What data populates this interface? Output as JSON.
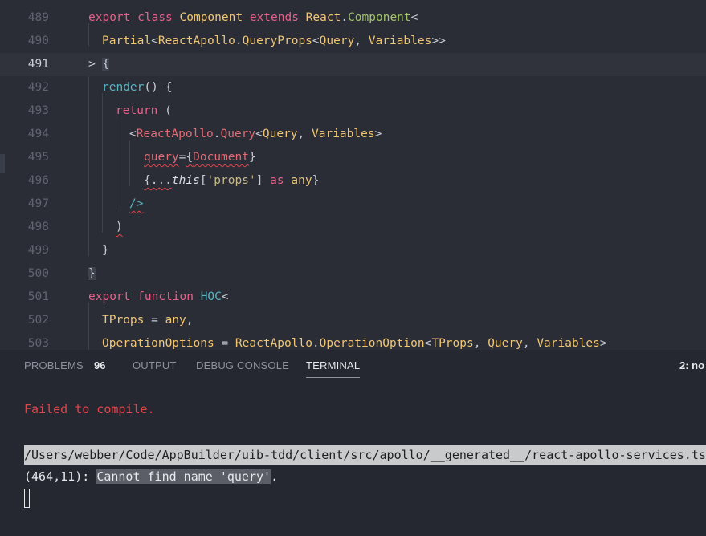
{
  "editor": {
    "lines": [
      {
        "n": "489"
      },
      {
        "n": "490"
      },
      {
        "n": "491"
      },
      {
        "n": "492"
      },
      {
        "n": "493"
      },
      {
        "n": "494"
      },
      {
        "n": "495"
      },
      {
        "n": "496"
      },
      {
        "n": "497"
      },
      {
        "n": "498"
      },
      {
        "n": "499"
      },
      {
        "n": "500"
      },
      {
        "n": "501"
      },
      {
        "n": "502"
      },
      {
        "n": "503"
      }
    ],
    "code": {
      "l489": [
        "export",
        " ",
        "class",
        " ",
        "Component",
        " ",
        "extends",
        " ",
        "React",
        ".",
        "Component",
        "<"
      ],
      "l490": [
        "Partial",
        "<",
        "ReactApollo",
        ".",
        "QueryProps",
        "<",
        "Query",
        ", ",
        "Variables",
        ">>"
      ],
      "l491": [
        "> ",
        "{"
      ],
      "l492": [
        "render",
        "() {"
      ],
      "l493": [
        "return",
        " ("
      ],
      "l494": [
        "<",
        "ReactApollo",
        ".",
        "Query",
        "<",
        "Query",
        ", ",
        "Variables",
        ">"
      ],
      "l495": [
        "query",
        "=",
        "{",
        "Document",
        "}"
      ],
      "l496": [
        "{...",
        "this",
        "[",
        "'props'",
        "] ",
        "as",
        " ",
        "any",
        "}"
      ],
      "l497": [
        "/>"
      ],
      "l498": [
        ")"
      ],
      "l499": [
        "}"
      ],
      "l500": [
        "}"
      ],
      "l501": [
        "export",
        " ",
        "function",
        " ",
        "HOC",
        "<"
      ],
      "l502": [
        "TProps",
        " = ",
        "any",
        ","
      ],
      "l503": [
        "OperationOptions",
        " = ",
        "ReactApollo",
        ".",
        "OperationOption",
        "<",
        "TProps",
        ", ",
        "Query",
        ", ",
        "Variables",
        ">"
      ]
    }
  },
  "panel": {
    "tabs": {
      "problems": "PROBLEMS",
      "problems_count": "96",
      "output": "OUTPUT",
      "debug_console": "DEBUG CONSOLE",
      "terminal": "TERMINAL",
      "terminal_select": "2: no"
    },
    "terminal": {
      "error_heading": "Failed to compile.",
      "file_path": "/Users/webber/Code/AppBuilder/uib-tdd/client/src/apollo/__generated__/react-apollo-services.ts",
      "location": "(464,11): ",
      "message": "Cannot find name 'query'",
      "message_end": "."
    }
  }
}
